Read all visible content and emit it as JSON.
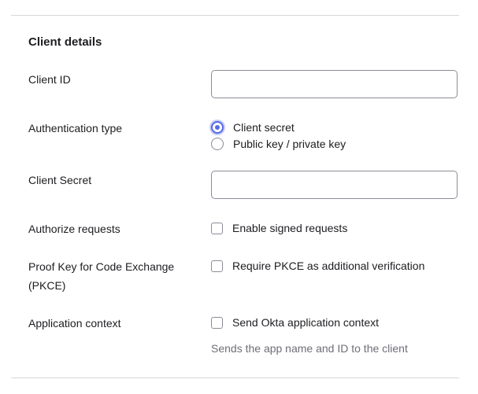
{
  "section": {
    "title": "Client details"
  },
  "fields": {
    "client_id": {
      "label": "Client ID",
      "value": "",
      "placeholder": ""
    },
    "auth_type": {
      "label": "Authentication type",
      "options": [
        {
          "label": "Client secret",
          "selected": true
        },
        {
          "label": "Public key / private key",
          "selected": false
        }
      ]
    },
    "client_secret": {
      "label": "Client Secret",
      "value": "",
      "placeholder": ""
    },
    "authorize_requests": {
      "label": "Authorize requests",
      "option_label": "Enable signed requests",
      "checked": false
    },
    "pkce": {
      "label_line1": "Proof Key for Code Exchange",
      "label_line2": "(PKCE)",
      "option_label": "Require PKCE as additional verification",
      "checked": false
    },
    "app_context": {
      "label": "Application context",
      "option_label": "Send Okta application context",
      "checked": false,
      "helper": "Sends the app name and ID to the client"
    }
  },
  "colors": {
    "accent": "#546be7",
    "border": "#8c8c96",
    "divider": "#d7d7dc",
    "helper_text": "#6e6e78"
  }
}
